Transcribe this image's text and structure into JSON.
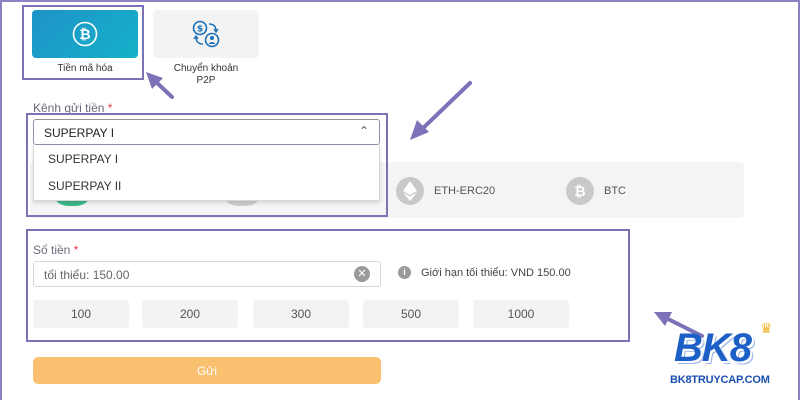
{
  "methods": [
    {
      "label": "Tiền mã hóa",
      "icon": "bitcoin-icon",
      "active": true
    },
    {
      "label_lines": [
        "Chuyển khoản",
        "P2P"
      ],
      "icon": "p2p-transfer-icon",
      "active": false
    }
  ],
  "channel": {
    "label": "Kênh gửi tiền",
    "required_mark": "*",
    "selected": "SUPERPAY I",
    "options": [
      "SUPERPAY I",
      "SUPERPAY II"
    ]
  },
  "coins": [
    {
      "label": "ETH-ERC20",
      "icon": "ethereum-icon"
    },
    {
      "label": "BTC",
      "icon": "bitcoin-icon"
    }
  ],
  "amount": {
    "label": "Số tiền",
    "required_mark": "*",
    "placeholder": "tối thiểu: 150.00",
    "limit_text": "Giới hạn tối thiểu: VND 150.00",
    "presets": [
      "100",
      "200",
      "300",
      "500",
      "1000"
    ]
  },
  "submit_label": "Gửi",
  "brand": {
    "logo_text": "BK8",
    "url": "BK8TRUYCAP.COM"
  },
  "colors": {
    "accent_gradient_start": "#1e93c7",
    "accent_gradient_end": "#15b1c9",
    "submit": "#f9c06f",
    "highlight": "#7b72b8",
    "required": "#e23b4b",
    "brand": "#1b5fc7"
  }
}
